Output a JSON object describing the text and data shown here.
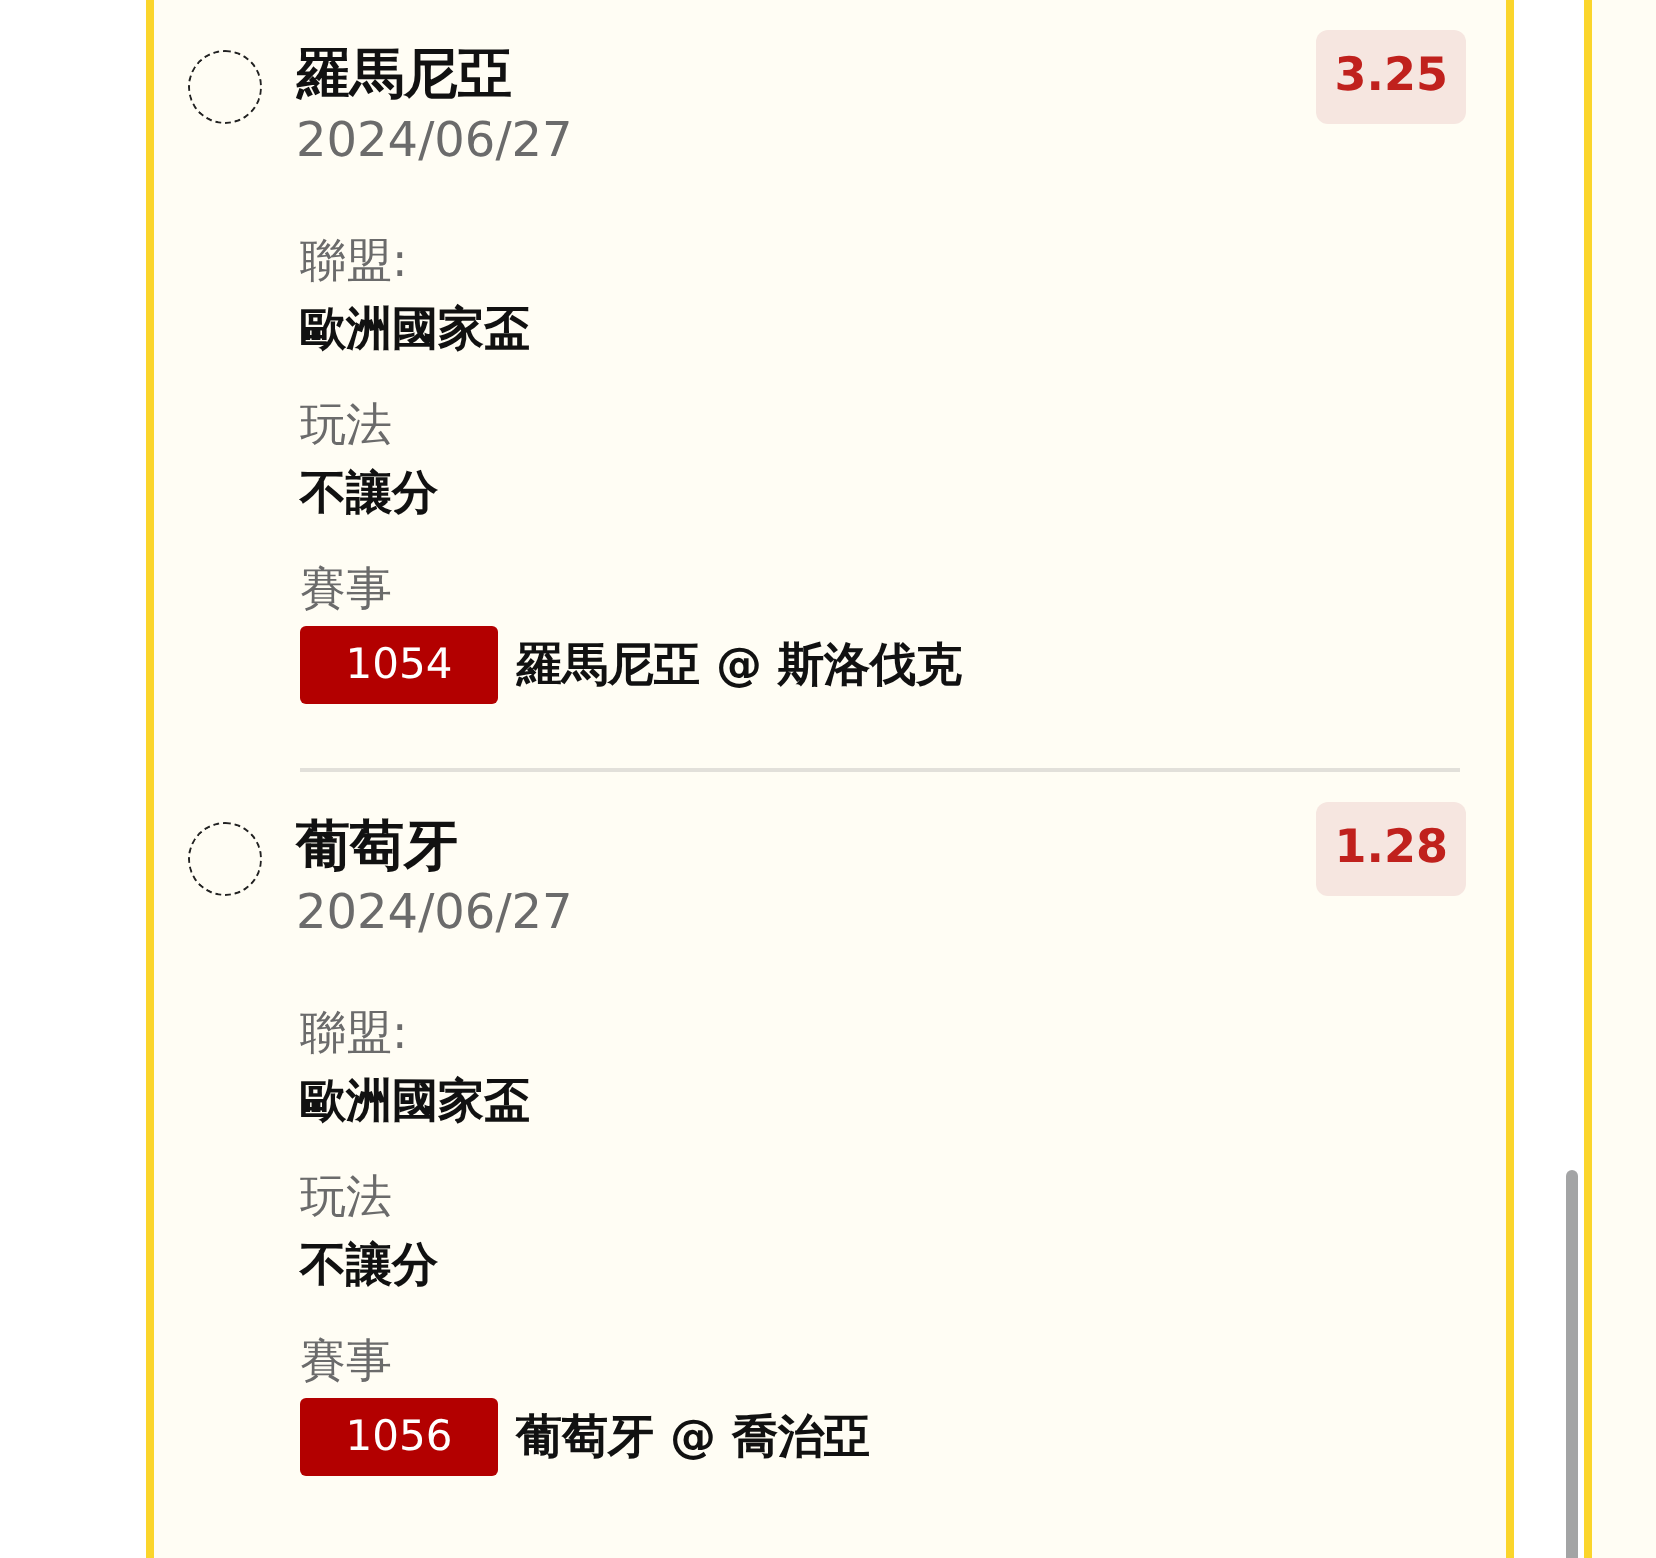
{
  "bets": [
    {
      "selection": "羅馬尼亞",
      "date": "2024/06/27",
      "odds": "3.25",
      "selected": false,
      "fields": [
        {
          "label": "聯盟:",
          "value": "歐洲國家盃"
        },
        {
          "label": "玩法",
          "value": "不讓分"
        }
      ],
      "match": {
        "label": "賽事",
        "code": "1054",
        "teams": "羅馬尼亞 @ 斯洛伐克"
      }
    },
    {
      "selection": "葡萄牙",
      "date": "2024/06/27",
      "odds": "1.28",
      "selected": false,
      "fields": [
        {
          "label": "聯盟:",
          "value": "歐洲國家盃"
        },
        {
          "label": "玩法",
          "value": "不讓分"
        }
      ],
      "match": {
        "label": "賽事",
        "code": "1056",
        "teams": "葡萄牙 @ 喬治亞"
      }
    }
  ]
}
